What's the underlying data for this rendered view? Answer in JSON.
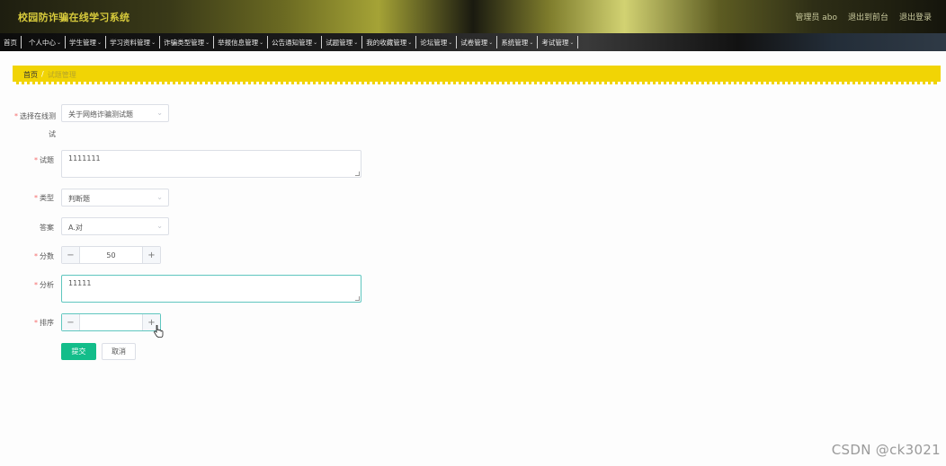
{
  "header": {
    "app_title": "校园防诈骗在线学习系统",
    "admin_label": "管理员 abo",
    "back_to_front": "退出到前台",
    "logout": "退出登录"
  },
  "nav": {
    "items": [
      {
        "label": "首页",
        "has_dropdown": false
      },
      {
        "label": "个人中心",
        "has_dropdown": true
      },
      {
        "label": "学生管理",
        "has_dropdown": true
      },
      {
        "label": "学习资料管理",
        "has_dropdown": true
      },
      {
        "label": "诈骗类型管理",
        "has_dropdown": true
      },
      {
        "label": "举报信息管理",
        "has_dropdown": true
      },
      {
        "label": "公告通知管理",
        "has_dropdown": true
      },
      {
        "label": "试题管理",
        "has_dropdown": true
      },
      {
        "label": "我的收藏管理",
        "has_dropdown": true
      },
      {
        "label": "论坛管理",
        "has_dropdown": true
      },
      {
        "label": "试卷管理",
        "has_dropdown": true
      },
      {
        "label": "系统管理",
        "has_dropdown": true
      },
      {
        "label": "考试管理",
        "has_dropdown": true
      }
    ]
  },
  "breadcrumb": {
    "home": "首页",
    "separator": "/",
    "current": "试题管理"
  },
  "form": {
    "exam_label": "选择在线测试",
    "exam_value": "关于网络诈骗测试题",
    "question_label": "试题",
    "question_value": "1111111",
    "type_label": "类型",
    "type_value": "判断题",
    "answer_label": "答案",
    "answer_value": "A.对",
    "score_label": "分数",
    "score_value": "50",
    "analysis_label": "分析",
    "analysis_value": "11111",
    "order_label": "排序",
    "order_value": "",
    "submit_label": "提交",
    "cancel_label": "取消"
  },
  "watermark": "CSDN @ck3021",
  "colors": {
    "breadcrumb_bg": "#f1d405",
    "primary_button": "#13bd8a",
    "focus_border": "#5fc6bf",
    "required_mark": "#f56c6c"
  }
}
